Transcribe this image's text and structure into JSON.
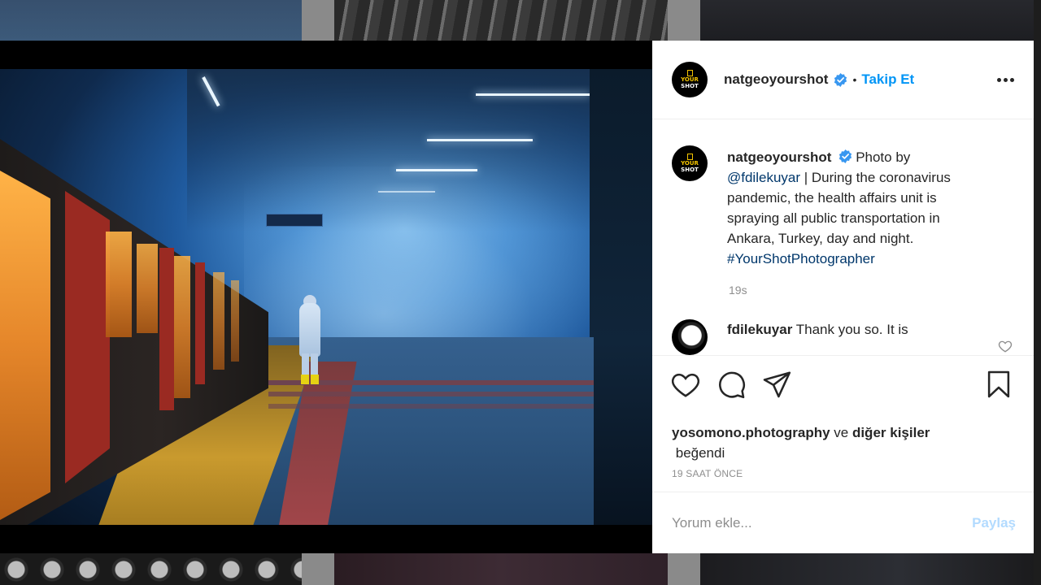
{
  "post": {
    "author": "natgeoyourshot",
    "separator": "•",
    "follow_label": "Takip Et",
    "avatar_text_top": "YOUR",
    "avatar_text_bottom": "SHOT",
    "caption": {
      "author": "natgeoyourshot",
      "text_1": "Photo by",
      "mention": "@fdilekuyar",
      "text_2": " | During the coronavirus pandemic, the health affairs unit is spraying all public transportation in Ankara, Turkey, day and night.",
      "hashtag": "#YourShotPhotographer",
      "time": "19s"
    },
    "comment": {
      "author": "fdilekuyar",
      "text": "Thank you so. It is"
    },
    "likes": {
      "first_user": "yosomono.photography",
      "connector": " ve ",
      "others": "diğer kişiler",
      "suffix": "beğendi"
    },
    "timestamp": "19 SAAT ÖNCE",
    "add_comment_placeholder": "Yorum ekle...",
    "share_label": "Paylaş"
  },
  "icons": {
    "like": "heart-icon",
    "comment": "comment-icon",
    "share": "paper-plane-icon",
    "save": "bookmark-icon",
    "more": "more-options-icon",
    "verified": "verified-badge-icon"
  },
  "colors": {
    "link_blue": "#0095f6",
    "verified_blue": "#3897f0",
    "share_disabled": "#b3dbff",
    "muted_text": "#8e8e8e",
    "brand_yellow": "#f4c400"
  }
}
